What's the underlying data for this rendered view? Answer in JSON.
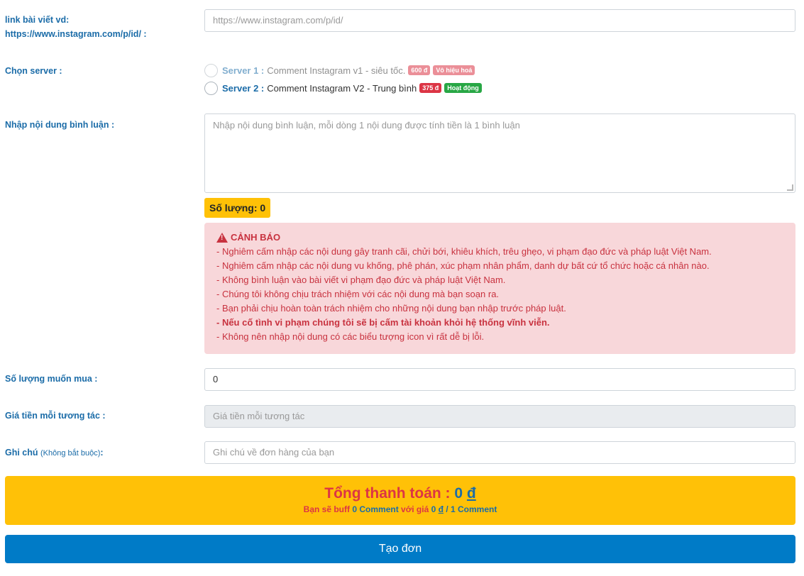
{
  "link": {
    "label_line1": "link bài viết vd:",
    "label_line2": "https://www.instagram.com/p/id/ :",
    "placeholder": "https://www.instagram.com/p/id/"
  },
  "server": {
    "label": "Chọn server :",
    "options": [
      {
        "name": "Server 1 :",
        "desc": "Comment Instagram v1 - siêu tốc.",
        "price": "600 đ",
        "status": "Vô hiệu hoá"
      },
      {
        "name": "Server 2 :",
        "desc": "Comment Instagram V2 - Trung bình",
        "price": "375 đ",
        "status": "Hoạt động"
      }
    ]
  },
  "comments": {
    "label": "Nhập nội dung bình luận :",
    "placeholder": "Nhập nội dung bình luận, mỗi dòng 1 nội dung được tính tiền là 1 bình luận",
    "count_label": "Số lượng: 0"
  },
  "warning": {
    "title": "CẢNH BÁO",
    "lines": [
      "- Nghiêm cấm nhập các nội dung gây tranh cãi, chửi bới, khiêu khích, trêu ghẹo, vi phạm đạo đức và pháp luật Việt Nam.",
      "- Nghiêm cấm nhập các nội dung vu khống, phê phán, xúc phạm nhân phẩm, danh dự bất cứ tổ chức hoặc cá nhân nào.",
      "- Không bình luận vào bài viết vi phạm đạo đức và pháp luật Việt Nam.",
      "- Chúng tôi không chịu trách nhiệm với các nội dung mà bạn soạn ra.",
      "- Bạn phải chịu hoàn toàn trách nhiệm cho những nội dung bạn nhập trước pháp luật.",
      "- Nếu cố tình vi phạm chúng tôi sẽ bị cấm tài khoản khỏi hệ thống vĩnh viễn.",
      "- Không nên nhập nội dung có các biểu tượng icon vì rất dễ bị lỗi."
    ]
  },
  "quantity": {
    "label": "Số lượng muốn mua :",
    "value": "0"
  },
  "price": {
    "label": "Giá tiền mỗi tương tác :",
    "placeholder": "Giá tiền mỗi tương tác"
  },
  "note": {
    "label": "Ghi chú",
    "label_small": "(Không bắt buộc)",
    "colon": ":",
    "placeholder": "Ghi chú về đơn hàng của bạn"
  },
  "total": {
    "title": "Tổng thanh toán :",
    "amount": "0",
    "currency": "đ",
    "sub_prefix": "Bạn sẽ buff",
    "sub_count": "0 Comment",
    "sub_mid": "với giá",
    "sub_price": "0",
    "sub_currency": "đ",
    "sub_suffix": "/ 1 Comment"
  },
  "submit_label": "Tạo đơn",
  "colors": {
    "accent": "#1b6ca8",
    "warning_bg": "#f8d7da",
    "warning_text": "#c8323f",
    "total_bg": "#ffc107",
    "submit_bg": "#007bc7"
  }
}
